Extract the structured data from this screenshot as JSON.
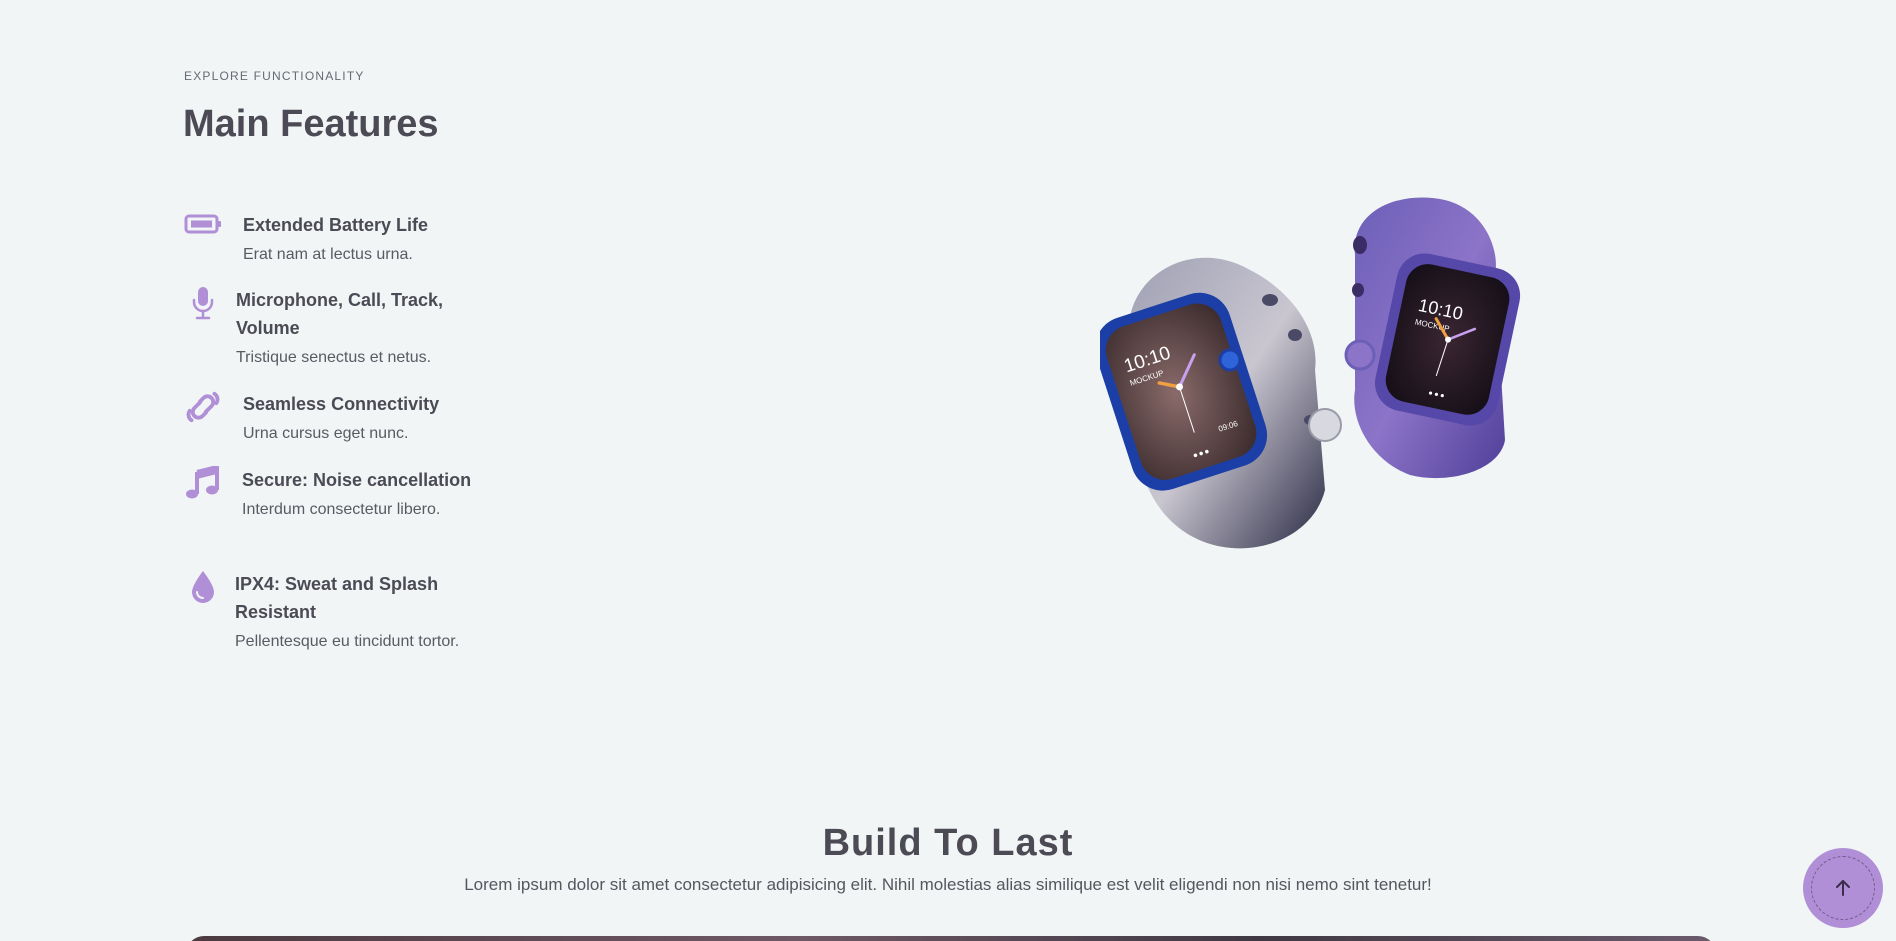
{
  "header": {
    "eyebrow": "EXPLORE FUNCTIONALITY",
    "title": "Main Features"
  },
  "features": [
    {
      "icon": "battery-icon",
      "title": "Extended Battery Life",
      "desc": "Erat nam at lectus urna."
    },
    {
      "icon": "microphone-icon",
      "title": "Microphone, Call, Track, Volume",
      "desc": "Tristique senectus et netus."
    },
    {
      "icon": "link-icon",
      "title": "Seamless Connectivity",
      "desc": "Urna cursus eget nunc."
    },
    {
      "icon": "music-note-icon",
      "title": "Secure: Noise cancellation",
      "desc": "Interdum consectetur libero."
    },
    {
      "icon": "water-drop-icon",
      "title": "IPX4: Sweat and Splash Resistant",
      "desc": "Pellentesque eu tincidunt tortor."
    }
  ],
  "watch_faces": {
    "left_time": "10:10",
    "left_label": "MOCKUP",
    "left_date": "09:06",
    "right_time": "10:10",
    "right_label": "MOCKUP"
  },
  "build_section": {
    "title": "Build To Last",
    "subtitle": "Lorem ipsum dolor sit amet consectetur adipisicing elit. Nihil molestias alias similique est velit eligendi non nisi nemo sint tenetur!"
  },
  "colors": {
    "accent": "#b08fd6",
    "background": "#f1f5f6",
    "text": "#4c4b55"
  }
}
